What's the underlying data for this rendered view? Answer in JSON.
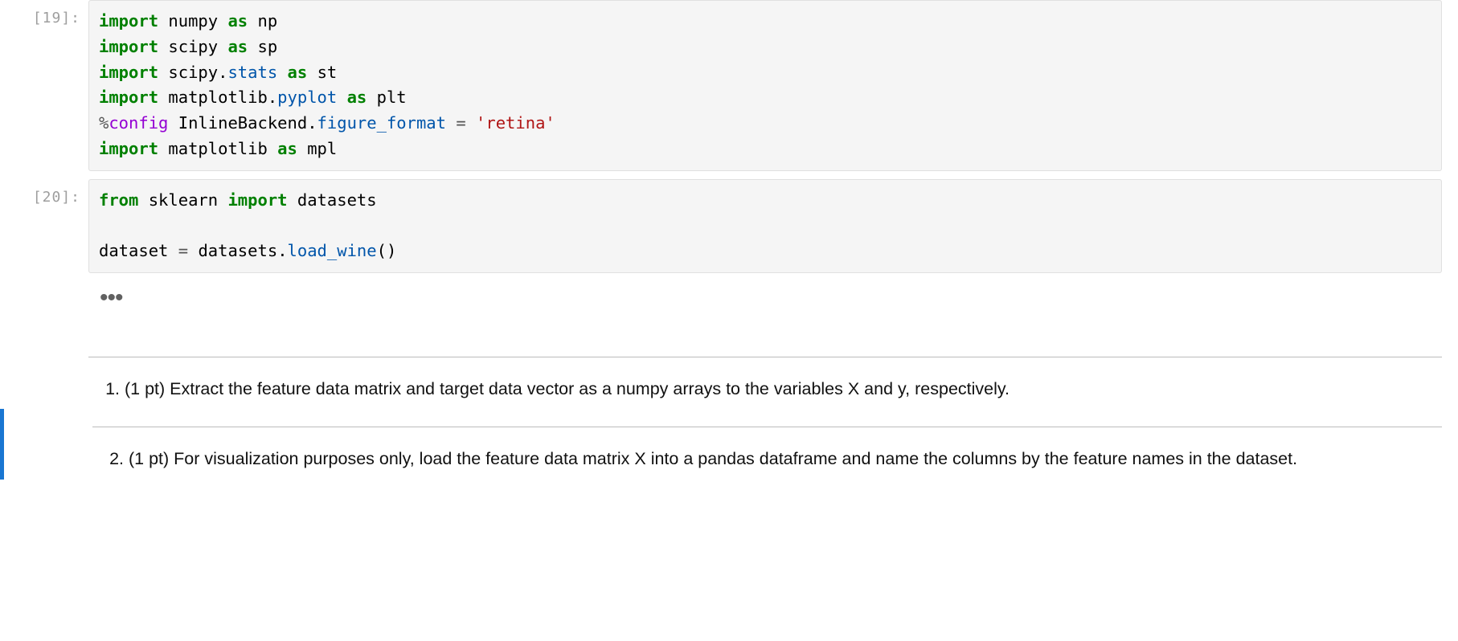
{
  "cells": {
    "c1": {
      "prompt": "[19]:",
      "code": {
        "l1": {
          "kw1": "import",
          "mod": "numpy",
          "kw2": "as",
          "alias": "np"
        },
        "l2": {
          "kw1": "import",
          "mod": "scipy",
          "kw2": "as",
          "alias": "sp"
        },
        "l3": {
          "kw1": "import",
          "mod1": "scipy",
          "dot": ".",
          "sub": "stats",
          "kw2": "as",
          "alias": "st"
        },
        "l4": {
          "kw1": "import",
          "mod1": "matplotlib",
          "dot": ".",
          "sub": "pyplot",
          "kw2": "as",
          "alias": "plt"
        },
        "l5": {
          "pct": "%",
          "magic": "config",
          "sp": " InlineBackend",
          "dot": ".",
          "attr": "figure_format",
          "eq": " = ",
          "str": "'retina'"
        },
        "l6": {
          "kw1": "import",
          "mod": "matplotlib",
          "kw2": "as",
          "alias": "mpl"
        }
      }
    },
    "c2": {
      "prompt": "[20]:",
      "code": {
        "l1": {
          "kw1": "from",
          "mod": "sklearn",
          "kw2": "import",
          "name": "datasets"
        },
        "l2": "",
        "l3": {
          "var": "dataset",
          "eq": " = ",
          "obj": "datasets",
          "dot": ".",
          "fn": "load_wine",
          "paren": "()"
        }
      }
    }
  },
  "ellipsis": "•••",
  "markdown": {
    "q1": "(1 pt) Extract the feature data matrix and target data vector as a numpy arrays to the variables X and y, respectively.",
    "q2": "(1 pt) For visualization purposes only, load the feature data matrix X into a pandas dataframe and name the columns by the feature names in the dataset."
  }
}
